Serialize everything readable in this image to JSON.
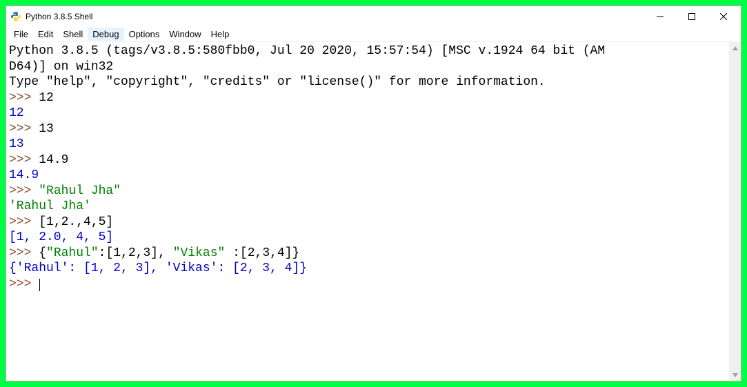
{
  "window": {
    "title": "Python 3.8.5 Shell"
  },
  "menu": {
    "items": [
      "File",
      "Edit",
      "Shell",
      "Debug",
      "Options",
      "Window",
      "Help"
    ],
    "highlighted": "Debug"
  },
  "shell": {
    "banner_line1": "Python 3.8.5 (tags/v3.8.5:580fbb0, Jul 20 2020, 15:57:54) [MSC v.1924 64 bit (AM",
    "banner_line2": "D64)] on win32",
    "banner_line3": "Type \"help\", \"copyright\", \"credits\" or \"license()\" for more information.",
    "prompt": ">>> ",
    "entries": [
      {
        "input_plain": "12",
        "output": "12",
        "out_class": "output-num"
      },
      {
        "input_plain": "13",
        "output": "13",
        "out_class": "output-num"
      },
      {
        "input_plain": "14.9",
        "output": "14.9",
        "out_class": "output-num"
      },
      {
        "input_str": "\"Rahul Jha\"",
        "output": "'Rahul Jha'",
        "out_class": "output-str"
      },
      {
        "input_plain": "[1,2.,4,5]",
        "output": "[1, 2.0, 4, 5]",
        "out_class": "output-num"
      },
      {
        "input_dict_pre": "{",
        "input_dict_k1": "\"Rahul\"",
        "input_dict_mid1": ":[1,2,3], ",
        "input_dict_k2": "\"Vikas\"",
        "input_dict_post": " :[2,3,4]}",
        "output": "{'Rahul': [1, 2, 3], 'Vikas': [2, 3, 4]}",
        "out_class": "output-num"
      }
    ]
  }
}
